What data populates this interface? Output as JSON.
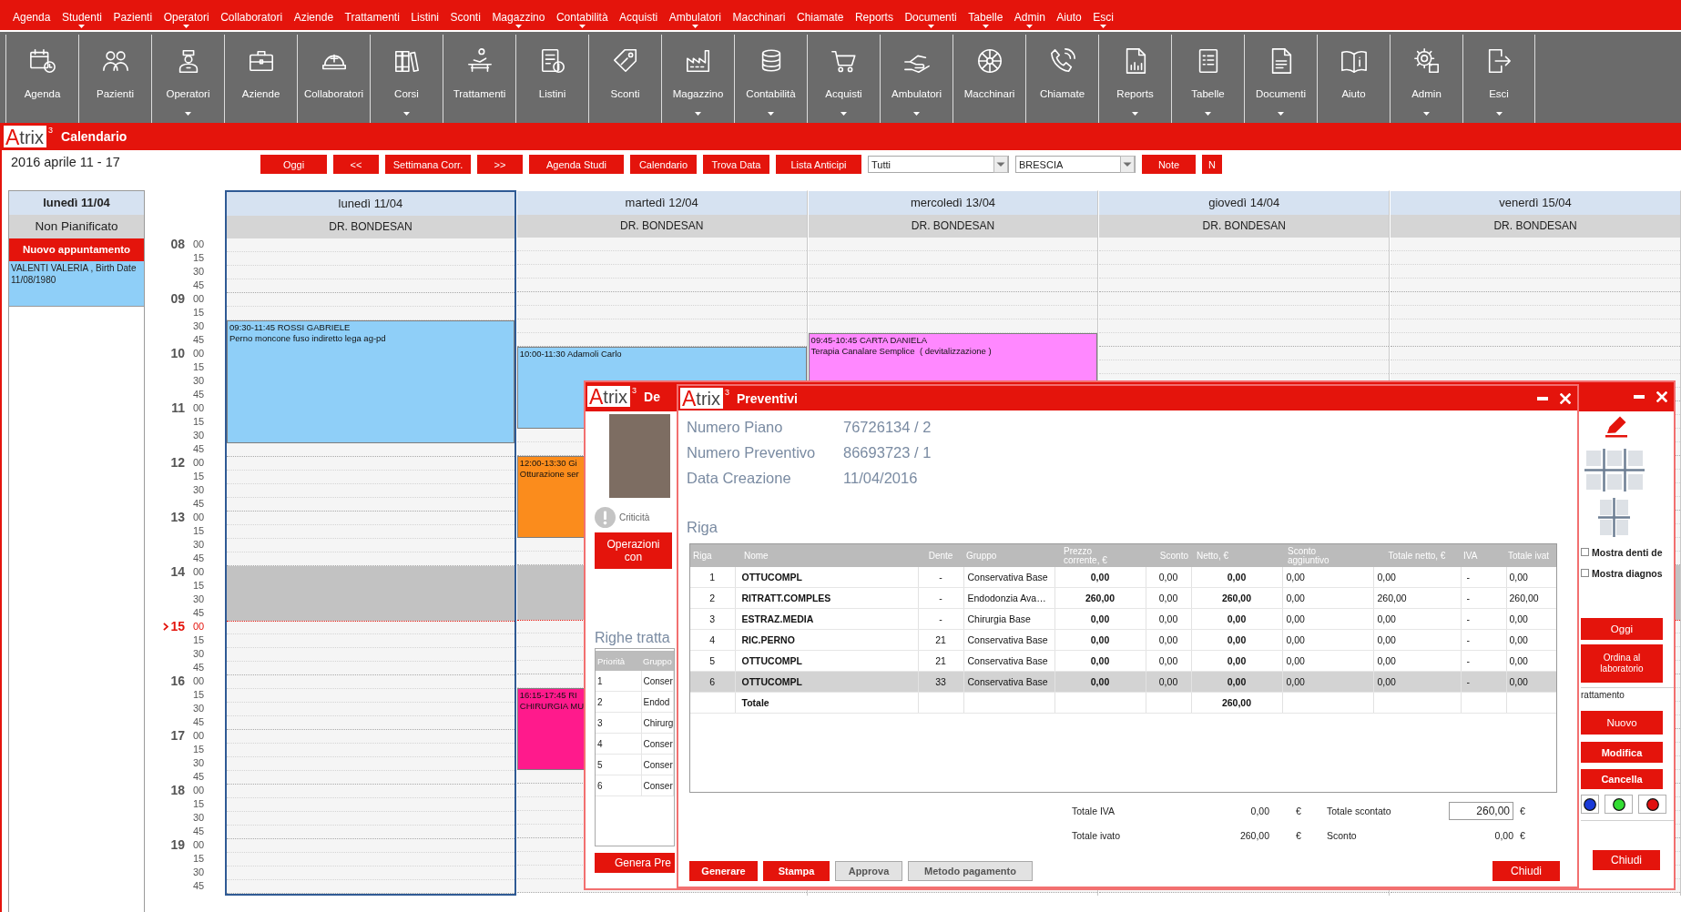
{
  "menu_bar": {
    "items": [
      {
        "label": "Agenda",
        "has_submenu": false
      },
      {
        "label": "Studenti",
        "has_submenu": true
      },
      {
        "label": "Pazienti",
        "has_submenu": false
      },
      {
        "label": "Operatori",
        "has_submenu": true
      },
      {
        "label": "Collaboratori",
        "has_submenu": false
      },
      {
        "label": "Aziende",
        "has_submenu": false
      },
      {
        "label": "Trattamenti",
        "has_submenu": false
      },
      {
        "label": "Listini",
        "has_submenu": false
      },
      {
        "label": "Sconti",
        "has_submenu": false
      },
      {
        "label": "Magazzino",
        "has_submenu": true
      },
      {
        "label": "Contabilità",
        "has_submenu": true
      },
      {
        "label": "Acquisti",
        "has_submenu": false
      },
      {
        "label": "Ambulatori",
        "has_submenu": true
      },
      {
        "label": "Macchinari",
        "has_submenu": false
      },
      {
        "label": "Chiamate",
        "has_submenu": false
      },
      {
        "label": "Reports",
        "has_submenu": false
      },
      {
        "label": "Documenti",
        "has_submenu": true
      },
      {
        "label": "Tabelle",
        "has_submenu": true
      },
      {
        "label": "Admin",
        "has_submenu": true
      },
      {
        "label": "Aiuto",
        "has_submenu": false
      },
      {
        "label": "Esci",
        "has_submenu": true
      }
    ]
  },
  "toolbar": {
    "buttons": [
      {
        "label": "Agenda",
        "has_submenu": false
      },
      {
        "label": "Pazienti",
        "has_submenu": false
      },
      {
        "label": "Operatori",
        "has_submenu": true
      },
      {
        "label": "Aziende",
        "has_submenu": false
      },
      {
        "label": "Collaboratori",
        "has_submenu": false
      },
      {
        "label": "Corsi",
        "has_submenu": true
      },
      {
        "label": "Trattamenti",
        "has_submenu": false
      },
      {
        "label": "Listini",
        "has_submenu": false
      },
      {
        "label": "Sconti",
        "has_submenu": false
      },
      {
        "label": "Magazzino",
        "has_submenu": true
      },
      {
        "label": "Contabilità",
        "has_submenu": true
      },
      {
        "label": "Acquisti",
        "has_submenu": true
      },
      {
        "label": "Ambulatori",
        "has_submenu": true
      },
      {
        "label": "Macchinari",
        "has_submenu": false
      },
      {
        "label": "Chiamate",
        "has_submenu": false
      },
      {
        "label": "Reports",
        "has_submenu": true
      },
      {
        "label": "Tabelle",
        "has_submenu": true
      },
      {
        "label": "Documenti",
        "has_submenu": true
      },
      {
        "label": "Aiuto",
        "has_submenu": false
      },
      {
        "label": "Admin",
        "has_submenu": true
      },
      {
        "label": "Esci",
        "has_submenu": true
      }
    ]
  },
  "calendar_window": {
    "logo": {
      "initial": "A",
      "rest": "trix",
      "version": "3"
    },
    "title": "Calendario",
    "date_range": "2016 aprile 11 - 17",
    "controls": [
      {
        "kind": "button",
        "label": "Oggi"
      },
      {
        "kind": "button",
        "label": "<<"
      },
      {
        "kind": "button",
        "label": "Settimana Corr."
      },
      {
        "kind": "button",
        "label": ">>"
      },
      {
        "kind": "button",
        "label": "Agenda Studi"
      },
      {
        "kind": "button",
        "label": "Calendario"
      },
      {
        "kind": "button",
        "label": "Trova Data"
      },
      {
        "kind": "button",
        "label": "Lista Anticipi"
      },
      {
        "kind": "dropdown",
        "value": "Tutti"
      },
      {
        "kind": "dropdown",
        "value": "BRESCIA"
      },
      {
        "kind": "button",
        "label": "Note"
      },
      {
        "kind": "button",
        "label": "N"
      }
    ],
    "unplanned": {
      "day": "lunedì 11/04",
      "title": "Non Pianificato",
      "new_button": "Nuovo appuntamento",
      "items": [
        {
          "text": "VALENTI VALERIA , Birth Date 11/08/1980"
        }
      ]
    },
    "schedule": {
      "hours": [
        {
          "label": "08",
          "minutes": [
            "00",
            "15",
            "30",
            "45"
          ],
          "current": false,
          "blocked": false
        },
        {
          "label": "09",
          "minutes": [
            "00",
            "15",
            "30",
            "45"
          ],
          "current": false,
          "blocked": false
        },
        {
          "label": "10",
          "minutes": [
            "00",
            "15",
            "30",
            "45"
          ],
          "current": false,
          "blocked": false
        },
        {
          "label": "11",
          "minutes": [
            "00",
            "15",
            "30",
            "45"
          ],
          "current": false,
          "blocked": false
        },
        {
          "label": "12",
          "minutes": [
            "00",
            "15",
            "30",
            "45"
          ],
          "current": false,
          "blocked": false
        },
        {
          "label": "13",
          "minutes": [
            "00",
            "15",
            "30",
            "45"
          ],
          "current": false,
          "blocked": false
        },
        {
          "label": "14",
          "minutes": [
            "00",
            "15",
            "30",
            "45"
          ],
          "current": false,
          "blocked": true
        },
        {
          "label": "15",
          "minutes": [
            "00",
            "15",
            "30",
            "45"
          ],
          "current": true,
          "blocked": false
        },
        {
          "label": "16",
          "minutes": [
            "00",
            "15",
            "30",
            "45"
          ],
          "current": false,
          "blocked": false
        },
        {
          "label": "17",
          "minutes": [
            "00",
            "15",
            "30",
            "45"
          ],
          "current": false,
          "blocked": false
        },
        {
          "label": "18",
          "minutes": [
            "00",
            "15",
            "30",
            "45"
          ],
          "current": false,
          "blocked": false
        },
        {
          "label": "19",
          "minutes": [
            "00",
            "15",
            "30",
            "45"
          ],
          "current": false,
          "blocked": false
        }
      ],
      "days": [
        {
          "label": "lunedì 11/04",
          "doctor": "DR. BONDESAN",
          "selected": true,
          "appointments": [
            {
              "time": "09:30-11:45",
              "patient": "ROSSI GABRIELE",
              "treatment": "Perno moncone fuso indiretto lega ag-pd",
              "color": "#8fcff8"
            }
          ]
        },
        {
          "label": "martedì 12/04",
          "doctor": "DR. BONDESAN",
          "selected": false,
          "appointments": [
            {
              "time": "10:00-11:30",
              "patient": "Adamoli Carlo",
              "color": "#8fcff8"
            },
            {
              "time": "12:00-13:30",
              "patient": "Gi",
              "treatment": "Otturazione ser",
              "color": "#fb8c1c"
            },
            {
              "time": "16:15-17:45",
              "patient": "RI",
              "treatment": "CHIRURGIA MU",
              "color": "#ff1a8c"
            }
          ]
        },
        {
          "label": "mercoledì 13/04",
          "doctor": "DR. BONDESAN",
          "selected": false,
          "appointments": [
            {
              "time": "09:45-10:45",
              "patient": "CARTA DANIELA",
              "treatment": "Terapia Canalare Semplice  ( devitalizzazione )",
              "color": "#ff88ff"
            }
          ]
        },
        {
          "label": "giovedì 14/04",
          "doctor": "DR. BONDESAN",
          "selected": false
        },
        {
          "label": "venerdì 15/04",
          "doctor": "DR. BONDESAN",
          "selected": false
        }
      ]
    }
  },
  "patient_window": {
    "logo": {
      "initial": "A",
      "rest": "trix",
      "version": "3"
    },
    "title": "De",
    "criticality": "Criticità",
    "operations_button": "Operazioni con",
    "treatments": {
      "heading": "Righe tratta",
      "columns": [
        "Priorità",
        "Gruppo"
      ],
      "rows": [
        {
          "cells": [
            "1",
            "Conser"
          ]
        },
        {
          "cells": [
            "2",
            "Endod"
          ]
        },
        {
          "cells": [
            "3",
            "Chirurg"
          ]
        },
        {
          "cells": [
            "4",
            "Conser"
          ]
        },
        {
          "cells": [
            "5",
            "Conser"
          ]
        },
        {
          "cells": [
            "6",
            "Conser"
          ]
        }
      ]
    },
    "generate_button": "Genera Pre",
    "tools": {
      "checkboxes": [
        {
          "label": "Mostra denti de",
          "checked": false
        },
        {
          "label": "Mostra diagnos",
          "checked": false
        }
      ],
      "buttons": [
        "Oggi",
        "Ordina al laboratorio"
      ],
      "group": {
        "label": "rattamento",
        "buttons": [
          "Nuovo",
          "Modifica",
          "Cancella"
        ],
        "colors": [
          {
            "color": "#1a3ad8"
          },
          {
            "color": "#33dd33"
          },
          {
            "color": "#e01010"
          }
        ]
      },
      "close_button": "Chiudi"
    }
  },
  "quote_window": {
    "logo": {
      "initial": "A",
      "rest": "trix",
      "version": "3"
    },
    "title": "Preventivi",
    "fields": [
      {
        "label": "Numero Piano",
        "value": "76726134 / 2"
      },
      {
        "label": "Numero Preventivo",
        "value": "86693723 / 1"
      },
      {
        "label": "Data Creazione",
        "value": "11/04/2016"
      }
    ],
    "section_title": "Riga",
    "table": {
      "columns": [
        "Riga",
        "Nome",
        "Dente",
        "Gruppo",
        "Prezzo corrente, €",
        "Sconto",
        "Netto, €",
        "Sconto aggiuntivo",
        "Totale netto, €",
        "IVA",
        "Totale ivat"
      ],
      "rows": [
        {
          "cells": [
            "1",
            "OTTUCOMPL",
            "-",
            "Conservativa Base",
            "0,00",
            "0,00",
            "0,00",
            "0,00",
            "0,00",
            "-",
            "0,00"
          ],
          "selected": false
        },
        {
          "cells": [
            "2",
            "RITRATT.COMPLES",
            "-",
            "Endodonzia Ava…",
            "260,00",
            "0,00",
            "260,00",
            "0,00",
            "260,00",
            "-",
            "260,00"
          ],
          "selected": false
        },
        {
          "cells": [
            "3",
            "ESTRAZ.MEDIA",
            "-",
            "Chirurgia Base",
            "0,00",
            "0,00",
            "0,00",
            "0,00",
            "0,00",
            "-",
            "0,00"
          ],
          "selected": false
        },
        {
          "cells": [
            "4",
            "RIC.PERNO",
            "21",
            "Conservativa Base",
            "0,00",
            "0,00",
            "0,00",
            "0,00",
            "0,00",
            "-",
            "0,00"
          ],
          "selected": false
        },
        {
          "cells": [
            "5",
            "OTTUCOMPL",
            "21",
            "Conservativa Base",
            "0,00",
            "0,00",
            "0,00",
            "0,00",
            "0,00",
            "-",
            "0,00"
          ],
          "selected": false
        },
        {
          "cells": [
            "6",
            "OTTUCOMPL",
            "33",
            "Conservativa Base",
            "0,00",
            "0,00",
            "0,00",
            "0,00",
            "0,00",
            "-",
            "0,00"
          ],
          "selected": true
        }
      ],
      "total": {
        "label": "Totale",
        "value": "260,00"
      }
    },
    "totals": [
      {
        "kind": "text",
        "label": "Totale IVA",
        "value": "0,00",
        "currency": "€"
      },
      {
        "kind": "field",
        "label": "Totale scontato",
        "value": "260,00",
        "currency": "€"
      },
      {
        "kind": "text",
        "label": "Totale ivato",
        "value": "260,00",
        "currency": "€"
      },
      {
        "kind": "text",
        "label": "Sconto",
        "value": "0,00",
        "currency": "€"
      }
    ],
    "buttons": [
      {
        "label": "Generare",
        "disabled": false
      },
      {
        "label": "Stampa",
        "disabled": false
      },
      {
        "label": "Approva",
        "disabled": true
      },
      {
        "label": "Metodo pagamento",
        "disabled": true
      }
    ],
    "close_button": "Chiudi"
  }
}
